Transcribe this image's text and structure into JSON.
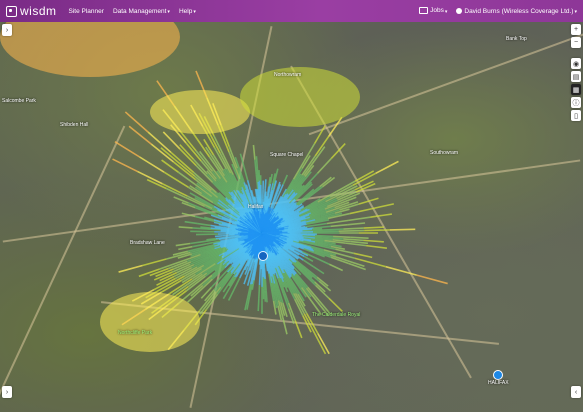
{
  "app": {
    "logo_text": "wisdm",
    "nav": [
      {
        "label": "Site Planner",
        "has_caret": false
      },
      {
        "label": "Data Management",
        "has_caret": true
      },
      {
        "label": "Help",
        "has_caret": true
      }
    ],
    "jobs_label": "Jobs",
    "user_label": "David Burns (Wireless Coverage Ltd.)",
    "brand_color": "#8a3594"
  },
  "map": {
    "labels": [
      {
        "text": "Salcombe Park"
      },
      {
        "text": "Shibden Hall"
      },
      {
        "text": "Northowram"
      },
      {
        "text": "Southowram"
      },
      {
        "text": "Northcliffe Park"
      },
      {
        "text": "The Calderdale Royal"
      },
      {
        "text": "Square Chapel"
      },
      {
        "text": "Halifax"
      },
      {
        "text": "Bradshaw Lane"
      },
      {
        "text": "Bank Top"
      },
      {
        "text": "HALIFAX"
      }
    ],
    "legend_colors": [
      "#2196f3",
      "#4fc3f7",
      "#66bb6a",
      "#9ccc65",
      "#cddc39",
      "#ffee58",
      "#ffb74d",
      "#ff8a65"
    ]
  },
  "toolbar": {
    "left_toggle": "›",
    "zoom_in": "+",
    "zoom_out": "−",
    "tools": [
      {
        "icon": "eye-icon",
        "glyph": "◉"
      },
      {
        "icon": "layers-icon",
        "glyph": "▤"
      },
      {
        "icon": "book-icon",
        "glyph": "▦"
      },
      {
        "icon": "info-icon",
        "glyph": "ⓘ"
      },
      {
        "icon": "phone-icon",
        "glyph": "▯"
      }
    ],
    "bottom_left": "›",
    "bottom_right": "‹"
  }
}
